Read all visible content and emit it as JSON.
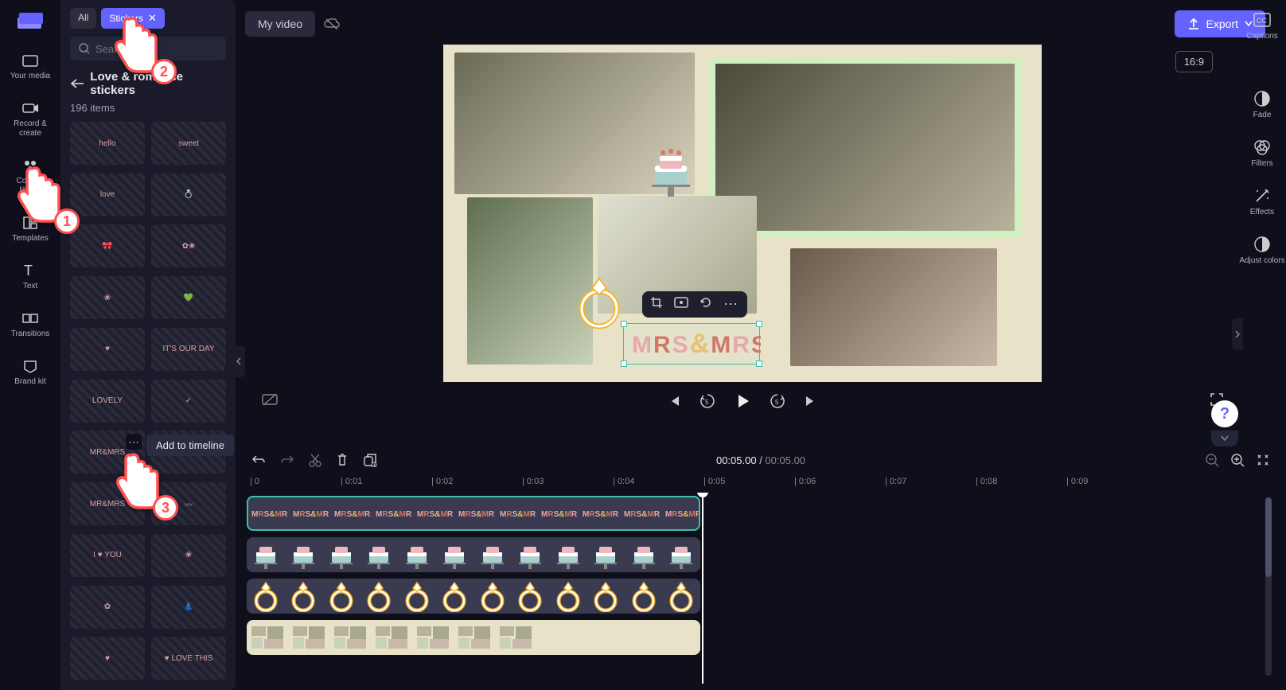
{
  "app": {
    "title": "My video",
    "export_label": "Export",
    "aspect_ratio": "16:9",
    "search_placeholder": "Search"
  },
  "leftnav": {
    "items": [
      {
        "id": "your-media",
        "label": "Your media"
      },
      {
        "id": "record-create",
        "label": "Record & create"
      },
      {
        "id": "content-library",
        "label": "Content library"
      },
      {
        "id": "templates",
        "label": "Templates"
      },
      {
        "id": "text",
        "label": "Text"
      },
      {
        "id": "transitions",
        "label": "Transitions"
      },
      {
        "id": "brand-kit",
        "label": "Brand kit"
      }
    ]
  },
  "panel": {
    "tabs": {
      "all": "All",
      "active": "Stickers"
    },
    "category": "Love & romance stickers",
    "count_label": "196 items",
    "stickers": [
      {
        "name": "hello-circle",
        "label": "hello"
      },
      {
        "name": "sweet-circle",
        "label": "sweet"
      },
      {
        "name": "love-badge",
        "label": "love"
      },
      {
        "name": "ring-outline",
        "label": "💍"
      },
      {
        "name": "bow",
        "label": "🎀"
      },
      {
        "name": "flower-cluster",
        "label": "✿❀"
      },
      {
        "name": "flower-bunch",
        "label": "❀"
      },
      {
        "name": "heart-sparkle",
        "label": "💚"
      },
      {
        "name": "pink-heart",
        "label": "♥"
      },
      {
        "name": "its-our-day",
        "label": "IT'S OUR DAY"
      },
      {
        "name": "lovely-badge",
        "label": "LOVELY"
      },
      {
        "name": "just-checked",
        "label": "✓"
      },
      {
        "name": "mr-and-mrs",
        "label": "MR&MRS"
      },
      {
        "name": "empty",
        "label": ""
      },
      {
        "name": "mr-and-mrs-2",
        "label": "MR&MRS"
      },
      {
        "name": "feather",
        "label": "〰"
      },
      {
        "name": "i-heart-you",
        "label": "I ♥ YOU"
      },
      {
        "name": "blue-flower",
        "label": "❀"
      },
      {
        "name": "pink-flowers",
        "label": "✿"
      },
      {
        "name": "dress",
        "label": "👗"
      },
      {
        "name": "pink-heart-small",
        "label": "♥"
      },
      {
        "name": "love-this-banner",
        "label": "♥ LOVE THIS"
      }
    ],
    "tooltip": "Add to timeline"
  },
  "rightrail": {
    "items": [
      {
        "id": "captions",
        "label": "Captions"
      },
      {
        "id": "fade",
        "label": "Fade"
      },
      {
        "id": "filters",
        "label": "Filters"
      },
      {
        "id": "effects",
        "label": "Effects"
      },
      {
        "id": "adjust-colors",
        "label": "Adjust colors"
      }
    ]
  },
  "canvas": {
    "mrsmrs_text": "MRS&MRS"
  },
  "timeline": {
    "current": "00:05.00",
    "duration": "00:05.00",
    "ticks": [
      "0",
      "0:01",
      "0:02",
      "0:03",
      "0:04",
      "0:05",
      "0:06",
      "0:07",
      "0:08",
      "0:09"
    ],
    "clip_text": "MRS&MRS"
  },
  "annotations": {
    "step1": "1",
    "step2": "2",
    "step3": "3"
  }
}
